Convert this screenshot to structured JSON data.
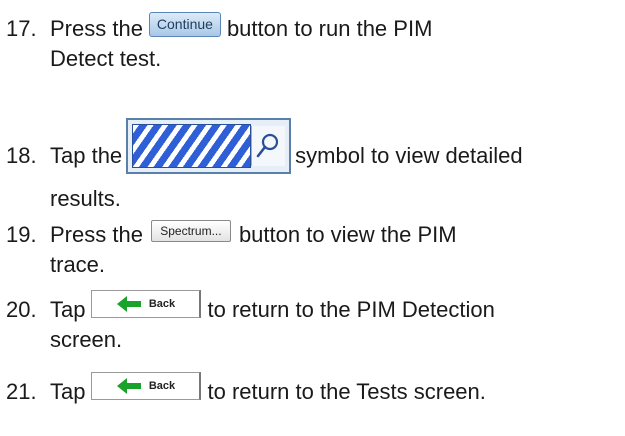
{
  "steps": [
    {
      "num": "17.",
      "before": "Press the",
      "button": "Continue",
      "after": "button to run the PIM",
      "cont": "Detect test."
    },
    {
      "num": "18.",
      "before": "Tap the",
      "after": "symbol to view detailed",
      "cont": "results."
    },
    {
      "num": "19.",
      "before": "Press the",
      "button": "Spectrum...",
      "after": "button to view the PIM",
      "cont": "trace."
    },
    {
      "num": "20.",
      "before": "Tap",
      "button": "Back",
      "after": "to return to the PIM Detection",
      "cont": "screen."
    },
    {
      "num": "21.",
      "before": "Tap",
      "button": "Back",
      "after": "to return to the Tests screen."
    }
  ],
  "colors": {
    "continue_button": "#a9c8e6",
    "hatch": "#2f5fd6",
    "back_arrow": "#1aa32a"
  },
  "icons": {
    "magnifier": "magnifier-icon",
    "back_arrow": "arrow-left-icon"
  }
}
